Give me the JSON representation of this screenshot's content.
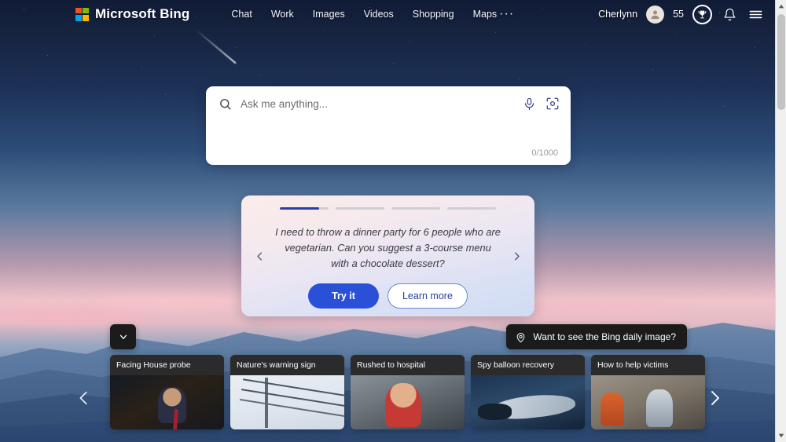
{
  "header": {
    "brand": "Microsoft Bing",
    "logo_icon": "microsoft-squares-logo",
    "nav": [
      {
        "label": "Chat"
      },
      {
        "label": "Work"
      },
      {
        "label": "Images"
      },
      {
        "label": "Videos"
      },
      {
        "label": "Shopping"
      },
      {
        "label": "Maps"
      }
    ],
    "more_label": "···",
    "user_name": "Cherlynn",
    "avatar_icon": "person-avatar-icon",
    "reward_points": "55",
    "reward_icon": "trophy-icon",
    "notifications_icon": "bell-icon",
    "menu_icon": "hamburger-menu-icon"
  },
  "search": {
    "search_icon": "search-icon",
    "placeholder": "Ask me anything...",
    "value": "",
    "mic_icon": "microphone-icon",
    "camera_icon": "visual-search-camera-icon",
    "char_count": "0/1000"
  },
  "promo": {
    "prev_icon": "chevron-left-icon",
    "next_icon": "chevron-right-icon",
    "prompt": "I need to throw a dinner party for 6 people who are vegetarian. Can you suggest a 3-course menu with a chocolate dessert?",
    "try_label": "Try it",
    "learn_label": "Learn more",
    "progress": [
      {
        "fill": "80%",
        "active": true
      },
      {
        "fill": "0%",
        "active": false
      },
      {
        "fill": "0%",
        "active": false
      },
      {
        "fill": "0%",
        "active": false
      }
    ],
    "accent_color": "#2a50d8",
    "active_bar_color": "#2a3fa5"
  },
  "daily_image_banner": {
    "icon": "map-pin-location-icon",
    "label": "Want to see the Bing daily image?"
  },
  "collapse_button": {
    "icon": "chevron-down-icon"
  },
  "news": {
    "prev_icon": "chevron-left-icon",
    "next_icon": "chevron-right-icon",
    "cards": [
      {
        "title": "Facing House probe",
        "thumb": "th1"
      },
      {
        "title": "Nature's warning sign",
        "thumb": "th2"
      },
      {
        "title": "Rushed to hospital",
        "thumb": "th3"
      },
      {
        "title": "Spy balloon recovery",
        "thumb": "th4"
      },
      {
        "title": "How to help victims",
        "thumb": "th5"
      }
    ]
  },
  "scrollbar": {
    "up_icon": "scroll-up-arrow-icon",
    "down_icon": "scroll-down-arrow-icon"
  }
}
